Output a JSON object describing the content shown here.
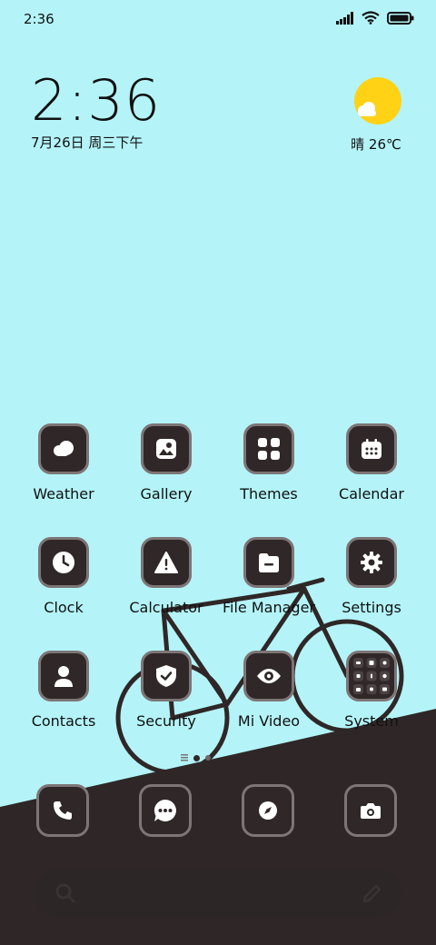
{
  "status_bar": {
    "time": "2:36"
  },
  "clock_widget": {
    "time": "2:36",
    "date": "7月26日 周三下午"
  },
  "weather_widget": {
    "text": "晴 26℃"
  },
  "apps": {
    "weather": "Weather",
    "gallery": "Gallery",
    "themes": "Themes",
    "calendar": "Calendar",
    "clock": "Clock",
    "calculator": "Calculator",
    "file_manager": "File Manager",
    "settings": "Settings",
    "contacts": "Contacts",
    "security": "Security",
    "mi_video": "Mi Video",
    "system": "System"
  },
  "dock": [
    "phone-icon",
    "messages-icon",
    "browser-compass-icon",
    "camera-icon"
  ],
  "colors": {
    "sky": "#b4f4f8",
    "ground": "#2f2727",
    "icon_bg": "#302828",
    "icon_border": "#7d7576",
    "sun": "#ffd215"
  }
}
